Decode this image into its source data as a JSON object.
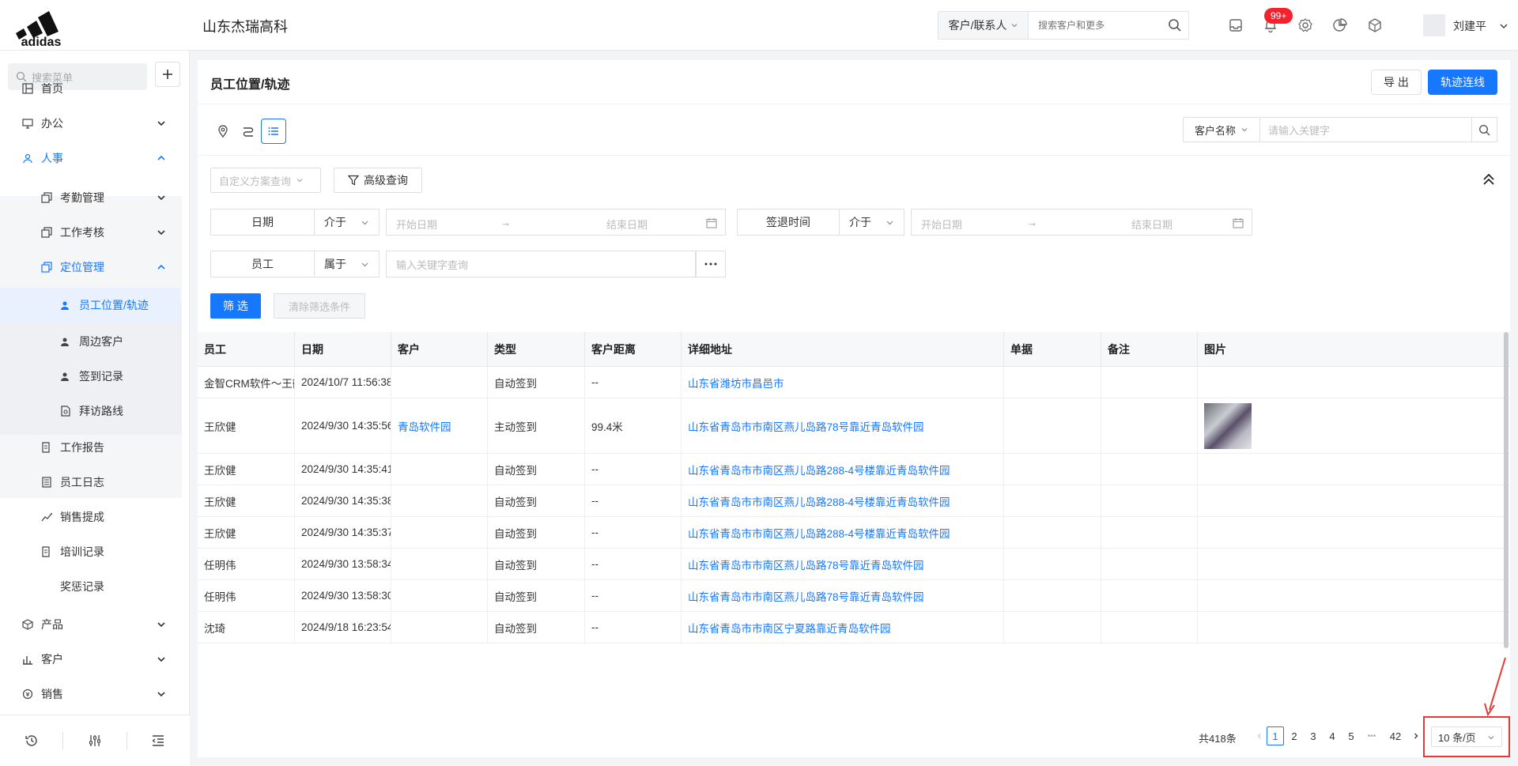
{
  "brand": {
    "logo_text": "adidas",
    "company": "山东杰瑞高科"
  },
  "header": {
    "search_type": "客户/联系人",
    "search_placeholder": "搜索客户和更多",
    "notification_badge": "99+",
    "user_name": "刘建平"
  },
  "sidebar": {
    "search_placeholder": "搜索菜单",
    "items": [
      {
        "label": "首页"
      },
      {
        "label": "办公"
      },
      {
        "label": "人事"
      },
      {
        "label": "考勤管理"
      },
      {
        "label": "工作考核"
      },
      {
        "label": "定位管理"
      },
      {
        "label": "员工位置/轨迹"
      },
      {
        "label": "周边客户"
      },
      {
        "label": "签到记录"
      },
      {
        "label": "拜访路线"
      },
      {
        "label": "工作报告"
      },
      {
        "label": "员工日志"
      },
      {
        "label": "销售提成"
      },
      {
        "label": "培训记录"
      },
      {
        "label": "奖惩记录"
      },
      {
        "label": "产品"
      },
      {
        "label": "客户"
      },
      {
        "label": "销售"
      }
    ]
  },
  "page": {
    "title": "员工位置/轨迹",
    "export_label": "导 出",
    "track_label": "轨迹连线",
    "customer_field": "客户名称",
    "customer_placeholder": "请输入关键字"
  },
  "filters": {
    "scheme_placeholder": "自定义方案查询",
    "advanced_label": "高级查询",
    "date_label": "日期",
    "date_op": "介于",
    "start_placeholder": "开始日期",
    "end_placeholder": "结束日期",
    "range_arrow": "→",
    "checkout_label": "签退时间",
    "checkout_op": "介于",
    "employee_label": "员工",
    "employee_op": "属于",
    "keyword_placeholder": "输入关键字查询",
    "filter_btn": "筛 选",
    "clear_btn": "清除筛选条件"
  },
  "table": {
    "columns": [
      "员工",
      "日期",
      "客户",
      "类型",
      "客户距离",
      "详细地址",
      "单据",
      "备注",
      "图片"
    ],
    "rows": [
      {
        "employee": "金智CRM软件～王鹤",
        "date": "2024/10/7 11:56:38",
        "customer": "",
        "type": "自动签到",
        "distance": "--",
        "address": "山东省潍坊市昌邑市",
        "doc": "",
        "note": "",
        "has_image": false
      },
      {
        "employee": "王欣健",
        "date": "2024/9/30 14:35:56",
        "customer": "青岛软件园",
        "type": "主动签到",
        "distance": "99.4米",
        "address": "山东省青岛市市南区燕儿岛路78号靠近青岛软件园",
        "doc": "",
        "note": "",
        "has_image": true
      },
      {
        "employee": "王欣健",
        "date": "2024/9/30 14:35:41",
        "customer": "",
        "type": "自动签到",
        "distance": "--",
        "address": "山东省青岛市市南区燕儿岛路288-4号楼靠近青岛软件园",
        "doc": "",
        "note": "",
        "has_image": false
      },
      {
        "employee": "王欣健",
        "date": "2024/9/30 14:35:38",
        "customer": "",
        "type": "自动签到",
        "distance": "--",
        "address": "山东省青岛市市南区燕儿岛路288-4号楼靠近青岛软件园",
        "doc": "",
        "note": "",
        "has_image": false
      },
      {
        "employee": "王欣健",
        "date": "2024/9/30 14:35:37",
        "customer": "",
        "type": "自动签到",
        "distance": "--",
        "address": "山东省青岛市市南区燕儿岛路288-4号楼靠近青岛软件园",
        "doc": "",
        "note": "",
        "has_image": false
      },
      {
        "employee": "任明伟",
        "date": "2024/9/30 13:58:34",
        "customer": "",
        "type": "自动签到",
        "distance": "--",
        "address": "山东省青岛市市南区燕儿岛路78号靠近青岛软件园",
        "doc": "",
        "note": "",
        "has_image": false
      },
      {
        "employee": "任明伟",
        "date": "2024/9/30 13:58:30",
        "customer": "",
        "type": "自动签到",
        "distance": "--",
        "address": "山东省青岛市市南区燕儿岛路78号靠近青岛软件园",
        "doc": "",
        "note": "",
        "has_image": false
      },
      {
        "employee": "沈琦",
        "date": "2024/9/18 16:23:54",
        "customer": "",
        "type": "自动签到",
        "distance": "--",
        "address": "山东省青岛市市南区宁夏路靠近青岛软件园",
        "doc": "",
        "note": "",
        "has_image": false
      }
    ]
  },
  "pagination": {
    "total": "共418条",
    "pages": [
      "1",
      "2",
      "3",
      "4",
      "5"
    ],
    "ellipsis": "•••",
    "last": "42",
    "page_size": "10 条/页"
  }
}
